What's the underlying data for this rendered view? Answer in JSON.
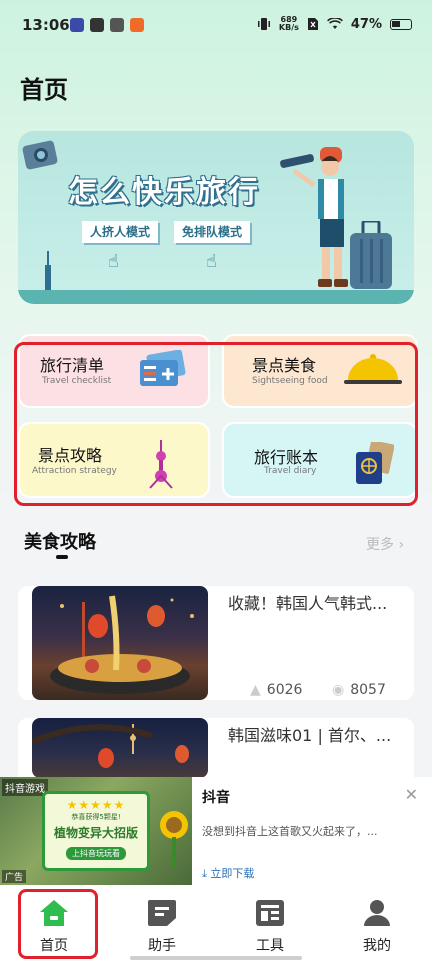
{
  "status_bar": {
    "time": "13:06",
    "net_speed_value": "689",
    "net_speed_unit": "KB/s",
    "battery": "47%"
  },
  "page": {
    "title": "首页"
  },
  "banner": {
    "title": "怎么快乐旅行",
    "button_1": "人挤人模式",
    "button_2": "免排队模式"
  },
  "quick_links": [
    {
      "title": "旅行清单",
      "subtitle": "Travel checklist",
      "icon": "ticket-icon"
    },
    {
      "title": "景点美食",
      "subtitle": "Sightseeing food",
      "icon": "food-cloche-icon"
    },
    {
      "title": "景点攻略",
      "subtitle": "Attraction strategy",
      "icon": "tower-icon"
    },
    {
      "title": "旅行账本",
      "subtitle": "Travel diary",
      "icon": "passport-icon"
    }
  ],
  "section": {
    "title": "美食攻略",
    "more": "更多"
  },
  "articles": [
    {
      "title": "收藏！韩国人气韩式...",
      "views": "6026",
      "likes": "8057"
    },
    {
      "title": "韩国滋味01 | 首尔、..."
    }
  ],
  "ad": {
    "brand_tag": "抖音游戏",
    "label": "广告",
    "image_small": "恭喜获得5颗星!",
    "image_big": "植物变异大招版",
    "image_cta": "上抖音玩玩看",
    "title": "抖音",
    "description": "没想到抖音上这首歌又火起来了，...",
    "download": "立即下载"
  },
  "nav": [
    {
      "label": "首页",
      "icon": "home-icon",
      "active": true
    },
    {
      "label": "助手",
      "icon": "assistant-icon",
      "active": false
    },
    {
      "label": "工具",
      "icon": "tools-icon",
      "active": false
    },
    {
      "label": "我的",
      "icon": "profile-icon",
      "active": false
    }
  ],
  "colors": {
    "accent_green": "#2ebd4e",
    "highlight_red": "#e0202a"
  }
}
